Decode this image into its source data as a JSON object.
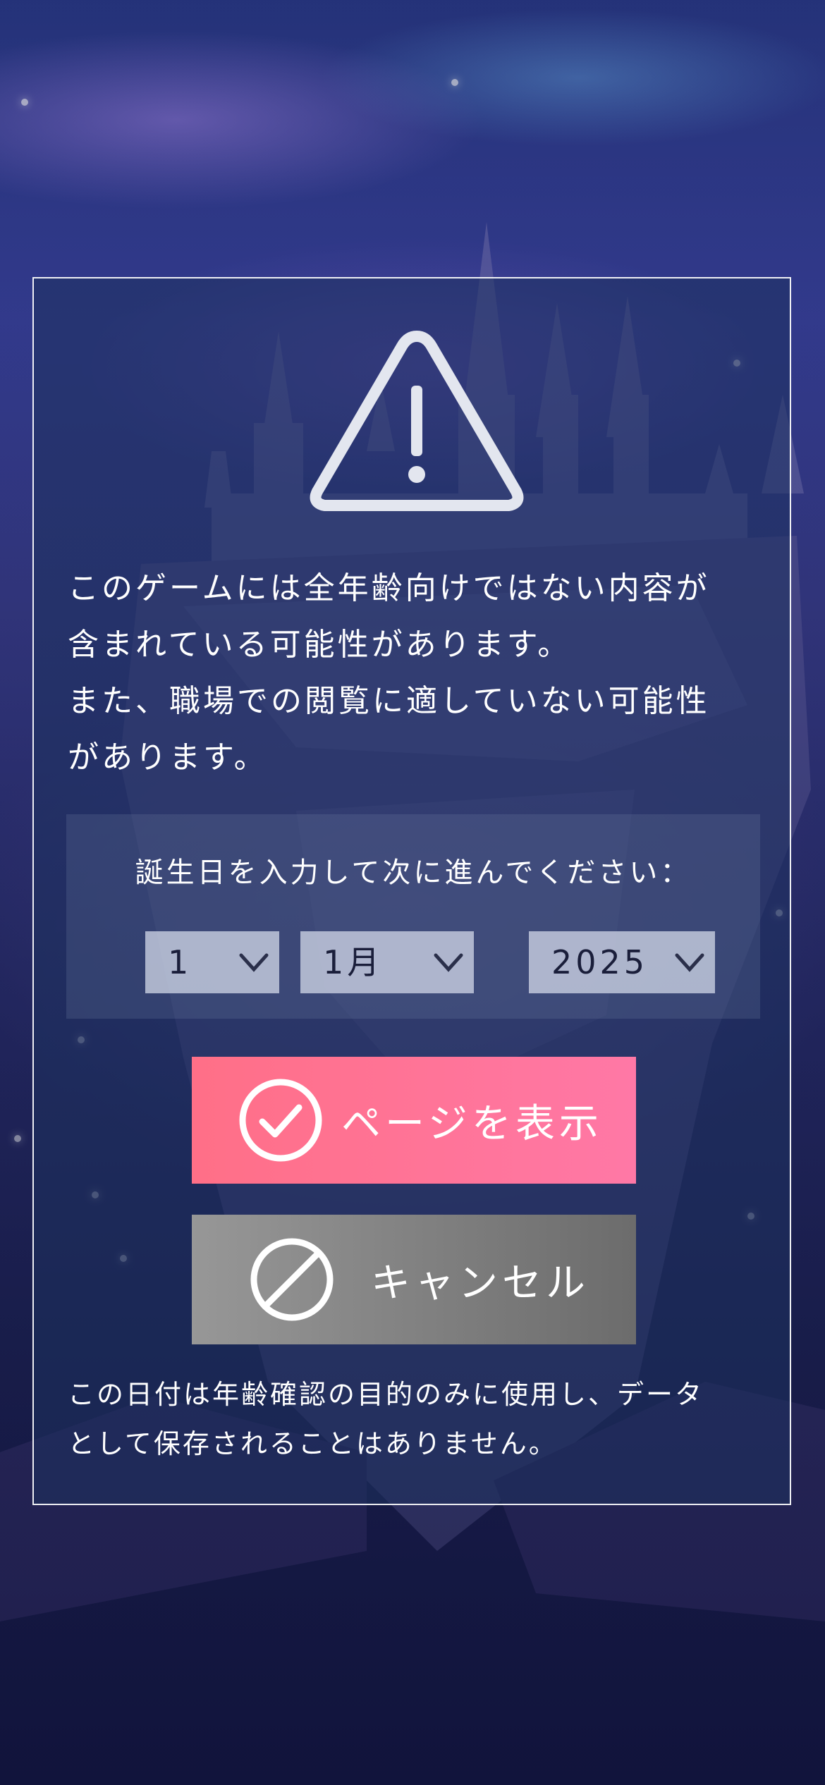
{
  "notice": {
    "lines": [
      "このゲームには全年齢向けではない内容が",
      "含まれている可能性があります。",
      "また、職場での閲覧に適していない可能性",
      "があります。"
    ]
  },
  "birthdate": {
    "label": "誕生日を入力して次に進んでください：",
    "day": "1",
    "month": "1月",
    "year": "2025"
  },
  "buttons": {
    "show_page": "ページを表示",
    "cancel": "キャンセル"
  },
  "disclaimer": {
    "lines": [
      "この日付は年齢確認の目的のみに使用し、データ",
      "として保存されることはありません。"
    ]
  },
  "icons": {
    "warning": "warning-triangle-icon",
    "confirm": "check-circle-icon",
    "cancel": "prohibited-circle-icon",
    "dropdown": "chevron-down-icon"
  },
  "colors": {
    "show_button": "#ff7296",
    "cancel_button": "#828282",
    "dialog_border": "#ffffff"
  }
}
